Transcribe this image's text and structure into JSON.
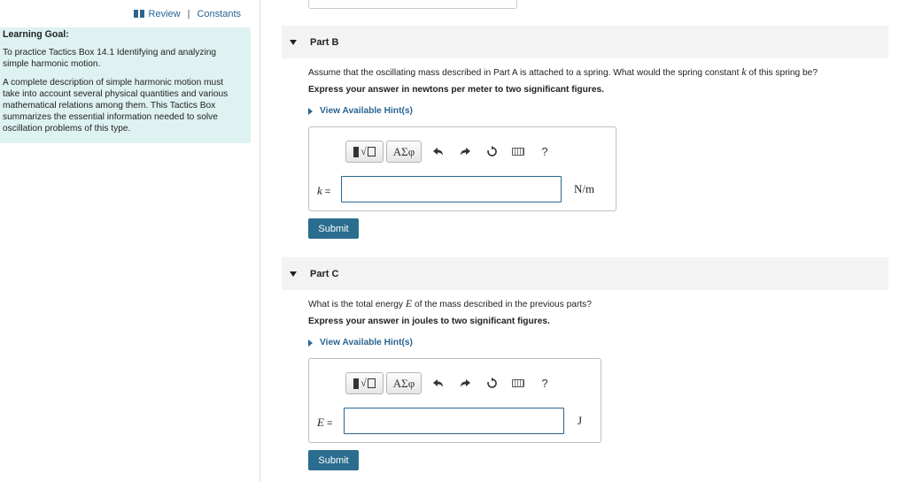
{
  "nav": {
    "review": "Review",
    "separator": "|",
    "constants": "Constants"
  },
  "learning_goal": {
    "heading": "Learning Goal:",
    "p1": "To practice Tactics Box 14.1 Identifying and analyzing simple harmonic motion.",
    "p2": "A complete description of simple harmonic motion must take into account several physical quantities and various mathematical relations among them. This Tactics Box summarizes the essential information needed to solve oscillation problems of this type."
  },
  "parts": [
    {
      "title": "Part B",
      "question_pre": "Assume that the oscillating mass described in Part A is attached to a spring. What would the spring constant ",
      "question_var": "k",
      "question_post": " of this spring be?",
      "instruction": "Express your answer in newtons per meter to two significant figures.",
      "hint": "View Available Hint(s)",
      "toolbar": {
        "greek": "ΑΣφ",
        "help": "?"
      },
      "variable": "k",
      "equals": "=",
      "input_value": "",
      "unit": "N/m",
      "submit": "Submit"
    },
    {
      "title": "Part C",
      "question_pre": "What is the total energy ",
      "question_var": "E",
      "question_post": " of the mass described in the previous parts?",
      "instruction": "Express your answer in joules to two significant figures.",
      "hint": "View Available Hint(s)",
      "toolbar": {
        "greek": "ΑΣφ",
        "help": "?"
      },
      "variable": "E",
      "equals": "=",
      "input_value": "",
      "unit": "J",
      "submit": "Submit"
    }
  ],
  "colors": {
    "link": "#2a6592",
    "goal_bg": "#dff2f2",
    "submit_bg": "#2a6d8e",
    "header_bg": "#f3f3f3"
  },
  "icons": [
    "book-icon",
    "undo-icon",
    "redo-icon",
    "reset-icon",
    "keyboard-icon",
    "help-icon"
  ]
}
